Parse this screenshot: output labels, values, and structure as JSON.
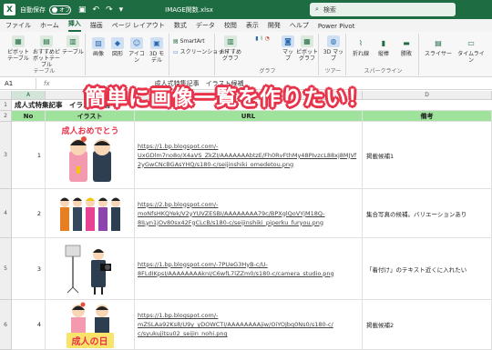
{
  "titlebar": {
    "autosave_label": "自動保存",
    "autosave_state": "オフ",
    "filename": "IMAGE関数.xlsx",
    "search_placeholder": "検索"
  },
  "tabs": [
    "ファイル",
    "ホーム",
    "挿入",
    "描画",
    "ページ レイアウト",
    "数式",
    "データ",
    "校閲",
    "表示",
    "開発",
    "ヘルプ",
    "Power Pivot"
  ],
  "active_tab": "挿入",
  "ribbon": {
    "groups": [
      {
        "label": "テーブル",
        "buttons": [
          "ピボットテーブル",
          "おすすめピボットテーブル",
          "テーブル"
        ]
      },
      {
        "label": "",
        "buttons": [
          "画像",
          "図形",
          "アイコン",
          "3D モデル"
        ]
      },
      {
        "label": "",
        "buttons": [
          "SmartArt",
          "スクリーンショット"
        ]
      },
      {
        "label": "グラフ",
        "buttons": [
          "おすすめグラフ",
          "マップ",
          "ピボットグラフ"
        ]
      },
      {
        "label": "",
        "buttons": [
          "3D マップ"
        ]
      },
      {
        "label": "スパークライン",
        "buttons": [
          "折れ線",
          "縦棒",
          "勝敗"
        ]
      },
      {
        "label": "",
        "buttons": [
          "スライサー",
          "タイムライン"
        ]
      }
    ],
    "tour_label": "ツアー"
  },
  "formula_bar": {
    "name_box": "A1",
    "fx": "fx",
    "content": "成人式特集記事　イラスト候補"
  },
  "columns": [
    "A",
    "B",
    "C",
    "D"
  ],
  "sheet": {
    "title": "成人式特集記事　イラスト候補",
    "headers": {
      "no": "No",
      "illust": "イラスト",
      "url": "URL",
      "note": "備考"
    },
    "rows": [
      {
        "row_num": "3",
        "no": "1",
        "url_lines": [
          "https://1.bp.blogspot.com/-",
          "UxGDlm7no8o/X4aVS_ZkZI/AAAAAAAbtzE/Fh0RvFthMy48PIvzcL88xj8MJVf",
          "2yGwCNcBGAsYHQ/s180-c/seijinshiki_omedetou.png"
        ],
        "note": "掲載候補1",
        "illust_caption": "成人おめでとう"
      },
      {
        "row_num": "4",
        "no": "2",
        "url_lines": [
          "https://2.bp.blogspot.com/-",
          "moNfsHKQYek/V2yYUVZESBI/AAAAAAAA79c/BPXglQoVYjM18Q-",
          "8ILyn1jOv80sx42FgCLcB/s180-c/seijinshiki_piperku_furyou.png"
        ],
        "note": "集合写真の候補。バリエーションあり",
        "illust_caption": ""
      },
      {
        "row_num": "5",
        "no": "3",
        "url_lines": [
          "https://1.bp.blogspot.com/-7PUeG3HyB-c/U-",
          "8FLdIKpsI/AAAAAAAAknI/C6wfL7lZZm0/s180-c/camera_studio.png"
        ],
        "note": "「着付け」のテキスト近くに入れたい",
        "illust_caption": ""
      },
      {
        "row_num": "6",
        "no": "4",
        "url_lines": [
          "https://1.bp.blogspot.com/-",
          "mZSLAa92Ks8/U9y_yDOWCTI/AAAAAAAAjiw/OiYOJbq0Ns0/s180-c/",
          "c/syukujitsu02_seijin_nohi.png"
        ],
        "note": "掲載候補2",
        "illust_caption": "成人の日"
      }
    ]
  },
  "overlay_text": "簡単に画像一覧を作りたい！",
  "colors": {
    "excel_green": "#1e6c41",
    "header_fill": "#9fe29c",
    "overlay_outline": "#e8334a"
  }
}
